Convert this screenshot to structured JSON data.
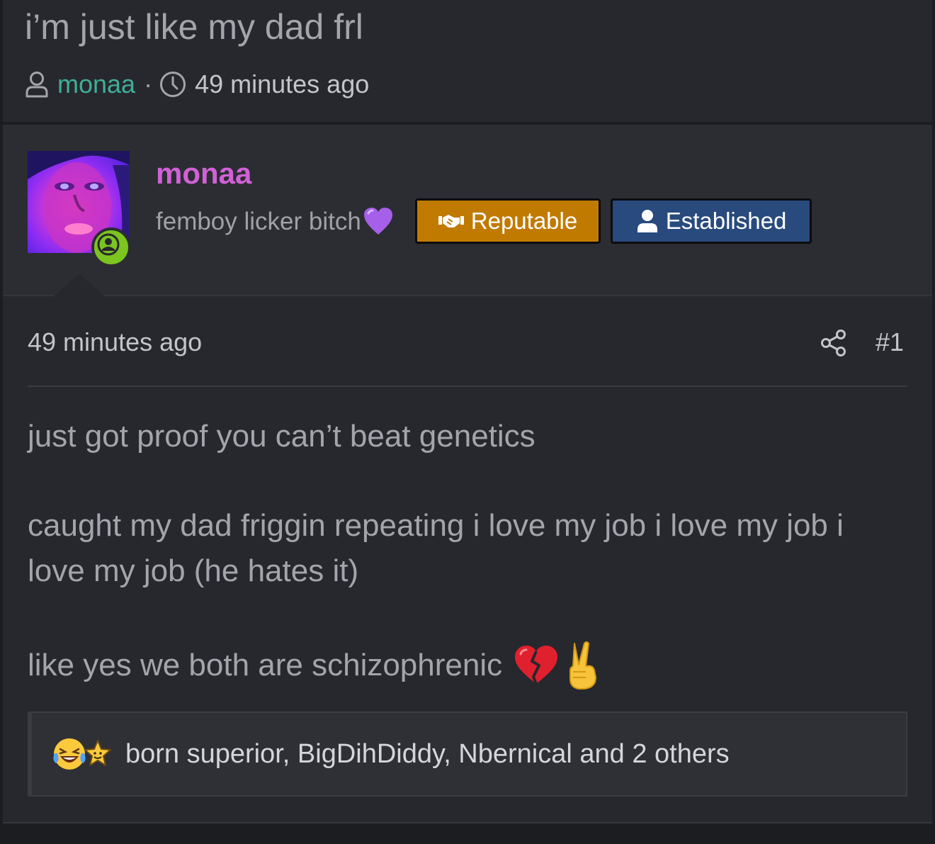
{
  "thread": {
    "title": "i’m just like my dad frl",
    "author": "monaa",
    "separator": "·",
    "time": "49 minutes ago"
  },
  "post": {
    "username": "monaa",
    "user_title": "femboy licker bitch",
    "banners": {
      "reputable": "Reputable",
      "established": "Established"
    },
    "date": "49 minutes ago",
    "number": "#1",
    "paragraphs": [
      "just got proof you can’t beat genetics",
      "caught my dad friggin repeating i love my job i love my job i love my job (he hates it)",
      "like yes we both are schizophrenic"
    ],
    "emojis": [
      "broken-heart-icon",
      "victory-hand-icon"
    ],
    "reactions": {
      "icons": [
        "laughing-tears-icon",
        "star-face-icon"
      ],
      "text": "born superior, BigDihDiddy, Nbernical and 2 others"
    }
  },
  "colors": {
    "username": "#d161d6",
    "author_link": "#3fae99",
    "reputable_banner": "#c17a00",
    "established_banner": "#294a7d",
    "online_badge": "#7cc41f"
  }
}
